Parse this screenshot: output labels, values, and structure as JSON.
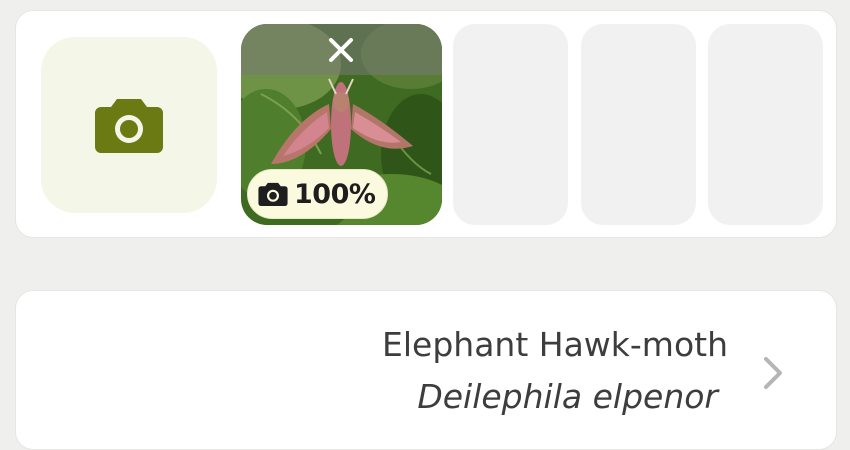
{
  "photos": {
    "add_photo_icon": "camera-icon",
    "thumbnail": {
      "close_icon": "close-icon",
      "badge_icon": "camera-icon",
      "badge_text": "100%"
    },
    "empty_slots": 3
  },
  "species": {
    "common_name": "Elephant Hawk-moth",
    "scientific_name": "Deilephila elpenor",
    "chevron_icon": "chevron-right-icon"
  },
  "colors": {
    "accent": "#6b7a12",
    "add_bg": "#f4f6e8",
    "slot_bg": "#f1f1f1",
    "page_bg": "#eff0ed",
    "badge_bg": "#fbfadf"
  }
}
